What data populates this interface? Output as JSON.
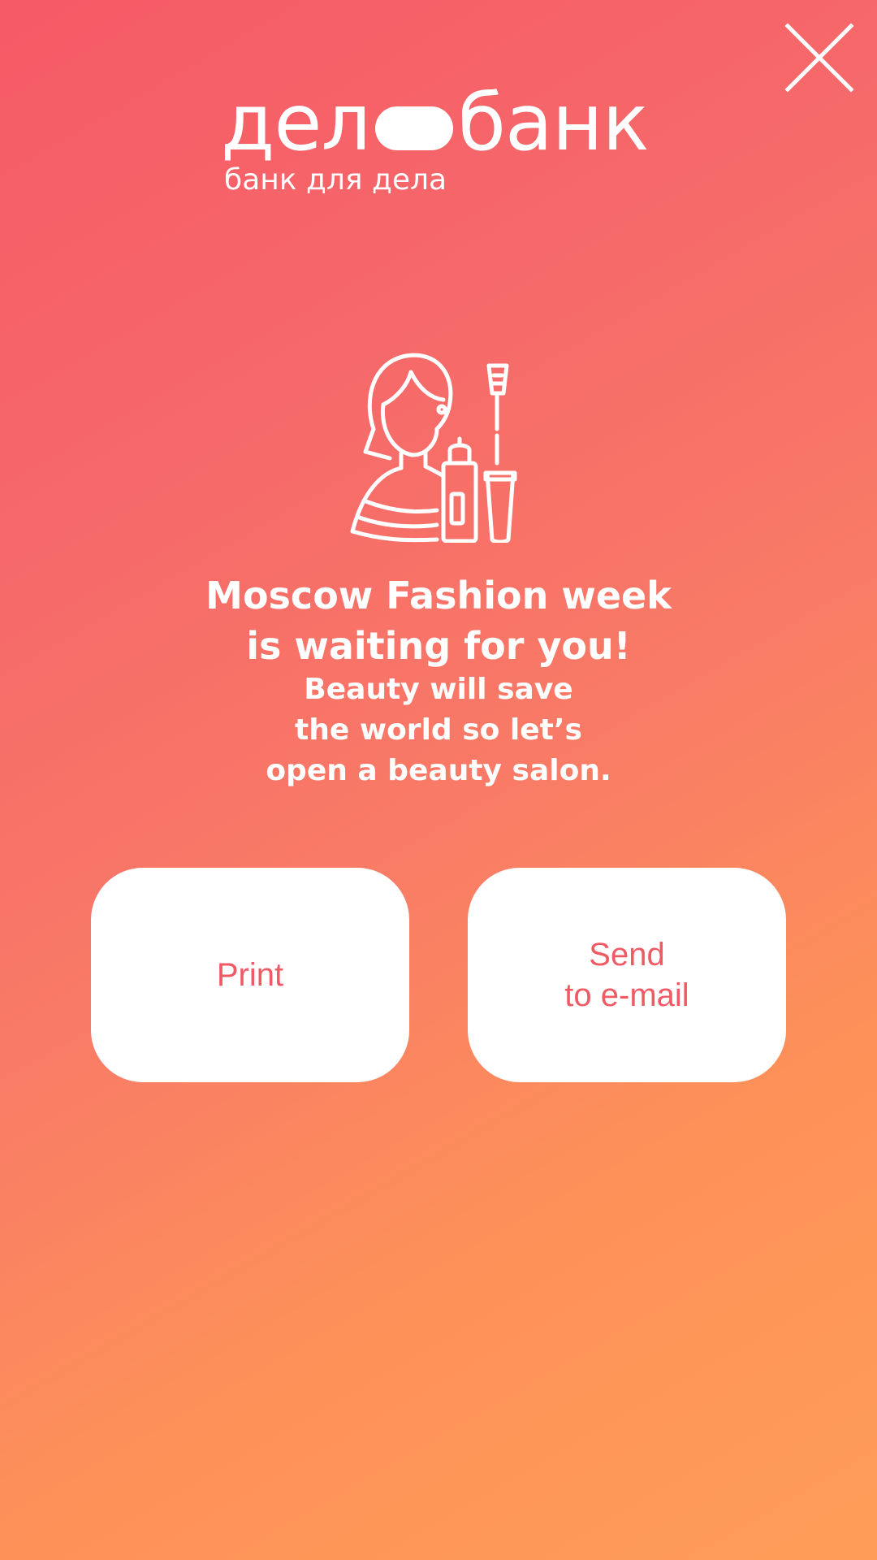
{
  "header": {
    "close_icon": "close-icon"
  },
  "logo": {
    "name_part1": "дел",
    "name_part2": "банк",
    "tagline": "банк для дела"
  },
  "hero": {
    "icon": "beauty-salon-icon",
    "headline": [
      "Moscow Fashion week",
      "is waiting for you!"
    ],
    "subline": [
      "Beauty will save",
      "the world so let’s",
      "open a beauty salon."
    ]
  },
  "actions": {
    "print": {
      "label": "Print"
    },
    "email": {
      "label_lines": [
        "Send",
        "to e-mail"
      ]
    }
  },
  "colors": {
    "gradient_start": "#f55a66",
    "gradient_end": "#ff9d58",
    "button_bg": "#ffffff",
    "button_text": "#ef5a64",
    "foreground": "#ffffff"
  }
}
